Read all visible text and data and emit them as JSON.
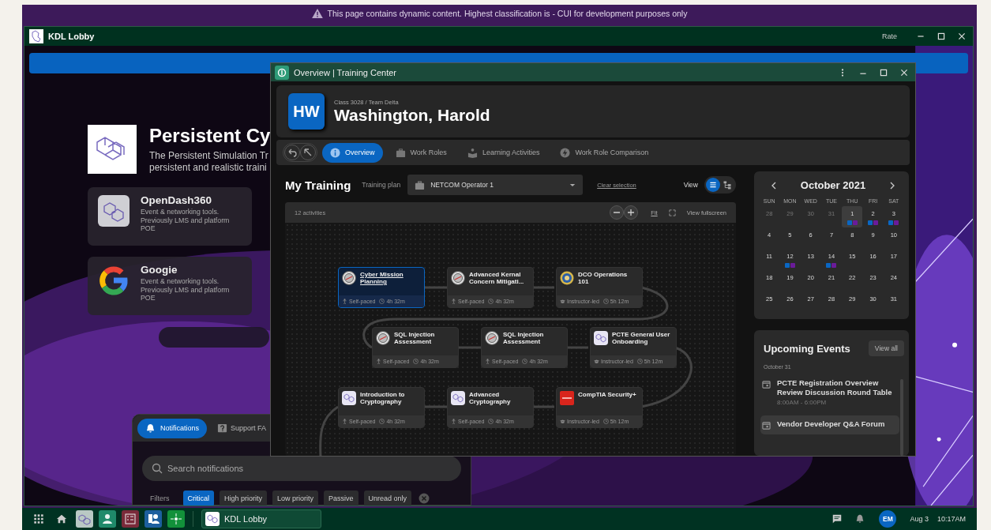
{
  "banner": {
    "text": "This page contains dynamic content. Highest classification is - CUI for development purposes only"
  },
  "lobby": {
    "title": "KDL Lobby",
    "rate": "Rate",
    "hero": {
      "title": "Persistent Cy",
      "lines": [
        "The Persistent Simulation Tr",
        "persistent and realistic traini"
      ]
    },
    "apps": [
      {
        "name": "OpenDash360",
        "description": "Event & networking tools. Previously LMS and platform POE",
        "kind": "kdl"
      },
      {
        "name": "Googie",
        "description": "Event & networking tools. Previously LMS and platform POE",
        "kind": "g"
      }
    ],
    "notifications": {
      "tabs": [
        {
          "label": "Notifications",
          "kind": "bell",
          "selected": true
        },
        {
          "label": "Support FA",
          "kind": "help",
          "selected": false
        }
      ],
      "search": {
        "placeholder": "Search notifications"
      },
      "filters_label": "Filters",
      "filters": [
        {
          "label": "Critical",
          "selected": true
        },
        {
          "label": "High priority",
          "selected": false
        },
        {
          "label": "Low priority",
          "selected": false
        },
        {
          "label": "Passive",
          "selected": false
        },
        {
          "label": "Unread only",
          "selected": false
        }
      ]
    }
  },
  "training": {
    "title": "Overview | Training Center",
    "avatar": "HW",
    "breadcrumb": "Class 3028 / Team Delta",
    "name": "Washington, Harold",
    "tabs": [
      {
        "label": "Overview",
        "kind": "info",
        "selected": true
      },
      {
        "label": "Work Roles",
        "kind": "briefcase",
        "selected": false
      },
      {
        "label": "Learning Activities",
        "kind": "reader",
        "selected": false
      },
      {
        "label": "Work Role Comparison",
        "kind": "bolt",
        "selected": false
      }
    ],
    "heading": "My Training",
    "plan_label": "Training plan",
    "plan": "NETCOM Operator 1",
    "clear": "Clear selection",
    "view_label": "View",
    "views": [
      {
        "kind": "list",
        "selected": true
      },
      {
        "kind": "tree",
        "selected": false
      }
    ],
    "activity_count": "12 activities",
    "fit": "Fit",
    "fullscreen": "View fullscreen",
    "activities": [
      {
        "title": "Cyber Mission Planning",
        "kind": "seal",
        "selected": true,
        "delivery": {
          "kind": "self",
          "label": "Self-paced"
        },
        "duration": "4h 32m"
      },
      {
        "title": "Advanced Kernal Concern Mitigati...",
        "kind": "seal",
        "selected": false,
        "delivery": {
          "kind": "self",
          "label": "Self-paced"
        },
        "duration": "4h 32m"
      },
      {
        "title": "DCO Operations 101",
        "kind": "badge",
        "selected": false,
        "delivery": {
          "kind": "instructor",
          "label": "Instructor-led"
        },
        "duration": "5h 12m"
      },
      {
        "title": "SQL Injection Assessment",
        "kind": "seal",
        "selected": false,
        "delivery": {
          "kind": "self",
          "label": "Self-paced"
        },
        "duration": "4h 32m"
      },
      {
        "title": "SQL Injection Assessment",
        "kind": "seal",
        "selected": false,
        "delivery": {
          "kind": "self",
          "label": "Self-paced"
        },
        "duration": "4h 32m"
      },
      {
        "title": "PCTE General User Onboarding",
        "kind": "kdl",
        "selected": false,
        "delivery": {
          "kind": "instructor",
          "label": "Instructor-led"
        },
        "duration": "5h 12m"
      },
      {
        "title": "Introduction to Cryptography",
        "kind": "kdl",
        "selected": false,
        "delivery": {
          "kind": "self",
          "label": "Self-paced"
        },
        "duration": "4h 32m"
      },
      {
        "title": "Advanced Cryptography",
        "kind": "kdl",
        "selected": false,
        "delivery": {
          "kind": "self",
          "label": "Self-paced"
        },
        "duration": "4h 32m"
      },
      {
        "title": "CompTIA Security+",
        "kind": "comptia",
        "selected": false,
        "delivery": {
          "kind": "instructor",
          "label": "Instructor-led"
        },
        "duration": "5h 12m"
      }
    ],
    "calendar": {
      "month": "October 2021",
      "weekdays": [
        "SUN",
        "MON",
        "WED",
        "TUE",
        "THU",
        "FRI",
        "SAT"
      ],
      "days": [
        {
          "day": "28",
          "muted": true,
          "selected": false
        },
        {
          "day": "29",
          "muted": true,
          "selected": false
        },
        {
          "day": "30",
          "muted": true,
          "selected": false
        },
        {
          "day": "31",
          "muted": true,
          "selected": false
        },
        {
          "day": "1",
          "muted": false,
          "selected": true,
          "dots": [
            {
              "color": "#0a66c2"
            },
            {
              "color": "#6a1b9a"
            }
          ]
        },
        {
          "day": "2",
          "muted": false,
          "selected": false,
          "dots": [
            {
              "color": "#0a66c2"
            },
            {
              "color": "#6a1b9a"
            }
          ]
        },
        {
          "day": "3",
          "muted": false,
          "selected": false,
          "dots": [
            {
              "color": "#0a66c2"
            },
            {
              "color": "#6a1b9a"
            }
          ]
        },
        {
          "day": "4",
          "muted": false,
          "selected": false
        },
        {
          "day": "5",
          "muted": false,
          "selected": false
        },
        {
          "day": "6",
          "muted": false,
          "selected": false
        },
        {
          "day": "7",
          "muted": false,
          "selected": false
        },
        {
          "day": "8",
          "muted": false,
          "selected": false
        },
        {
          "day": "9",
          "muted": false,
          "selected": false
        },
        {
          "day": "10",
          "muted": false,
          "selected": false
        },
        {
          "day": "11",
          "muted": false,
          "selected": false
        },
        {
          "day": "12",
          "muted": false,
          "selected": false,
          "dots": [
            {
              "color": "#0a66c2"
            },
            {
              "color": "#6a1b9a"
            }
          ]
        },
        {
          "day": "13",
          "muted": false,
          "selected": false
        },
        {
          "day": "14",
          "muted": false,
          "selected": false,
          "dots": [
            {
              "color": "#0a66c2"
            },
            {
              "color": "#6a1b9a"
            }
          ]
        },
        {
          "day": "15",
          "muted": false,
          "selected": false
        },
        {
          "day": "16",
          "muted": false,
          "selected": false
        },
        {
          "day": "17",
          "muted": false,
          "selected": false
        },
        {
          "day": "18",
          "muted": false,
          "selected": false
        },
        {
          "day": "19",
          "muted": false,
          "selected": false
        },
        {
          "day": "20",
          "muted": false,
          "selected": false
        },
        {
          "day": "21",
          "muted": false,
          "selected": false
        },
        {
          "day": "22",
          "muted": false,
          "selected": false
        },
        {
          "day": "23",
          "muted": false,
          "selected": false
        },
        {
          "day": "24",
          "muted": false,
          "selected": false
        },
        {
          "day": "25",
          "muted": false,
          "selected": false
        },
        {
          "day": "26",
          "muted": false,
          "selected": false
        },
        {
          "day": "27",
          "muted": false,
          "selected": false
        },
        {
          "day": "28",
          "muted": false,
          "selected": false
        },
        {
          "day": "29",
          "muted": false,
          "selected": false
        },
        {
          "day": "30",
          "muted": false,
          "selected": false
        },
        {
          "day": "31",
          "muted": false,
          "selected": false
        }
      ]
    },
    "events": {
      "title": "Upcoming Events",
      "view_all": "View all",
      "date": "October 31",
      "items": [
        {
          "title": "PCTE Registration Overview Review Discussion Round Table",
          "time": "8:00AM - 6:00PM",
          "selected": false
        },
        {
          "title": "Vendor Developer Q&A Forum",
          "selected": true
        }
      ]
    }
  },
  "taskbar": {
    "task": "KDL Lobby",
    "user": "EM",
    "date": "Aug 3",
    "time": "10:17AM"
  }
}
